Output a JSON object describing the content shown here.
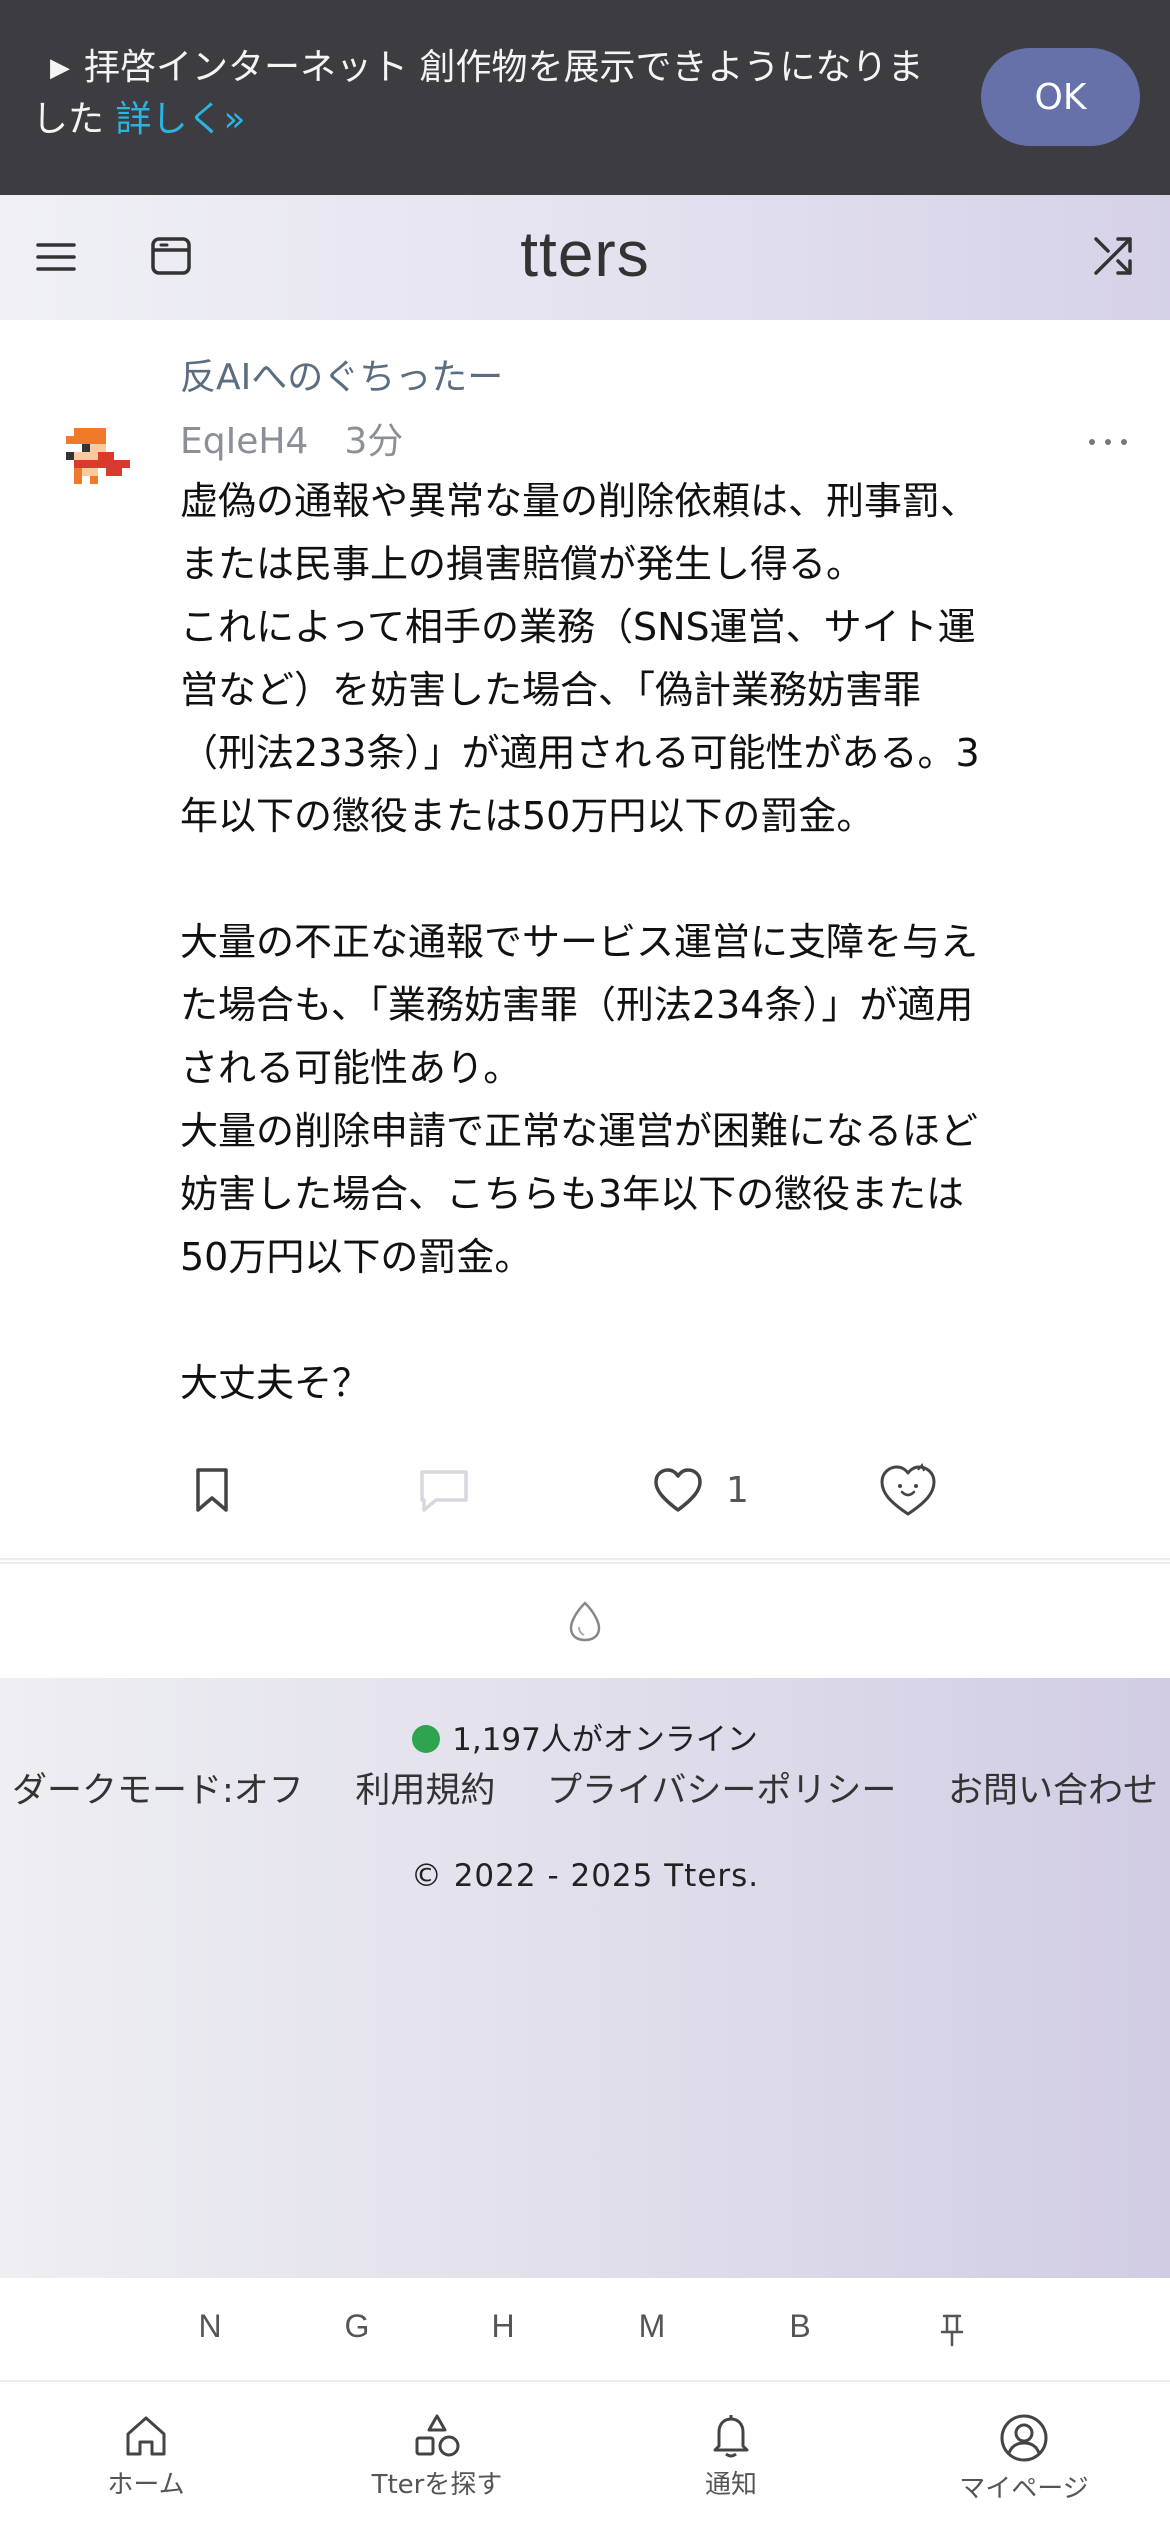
{
  "banner": {
    "text": "拝啓インターネット 創作物を展示できようになりました",
    "more_link": "詳しく»",
    "ok_label": "OK"
  },
  "header": {
    "logo": "tters",
    "icons": [
      "menu-icon",
      "window-icon",
      "shuffle-icon"
    ]
  },
  "post": {
    "source": "反AIへのぐちったー",
    "author": "EqIeH4",
    "time": "3分",
    "body": "虚偽の通報や異常な量の削除依頼は、刑事罰、\nまたは民事上の損害賠償が発生し得る。\nこれによって相手の業務（SNS運営、サイト運\n営など）を妨害した場合、「偽計業務妨害罪\n（刑法233条）」が適用される可能性がある。3\n年以下の懲役または50万円以下の罰金。\n\n大量の不正な通報でサービス運営に支障を与え\nた場合も、「業務妨害罪（刑法234条）」が適用\nされる可能性あり。\n大量の削除申請で正常な運営が困難になるほど\n妨害した場合、こちらも3年以下の懲役または\n50万円以下の罰金。\n\n大丈夫そ？",
    "like_count": "1"
  },
  "footer": {
    "online_text": "1,197人がオンライン",
    "links": [
      "ダークモード:オフ",
      "利用規約",
      "プライバシーポリシー",
      "お問い合わせ"
    ],
    "copyright": "© 2022 - 2025 Tters."
  },
  "shortcuts": [
    "N",
    "G",
    "H",
    "M",
    "B"
  ],
  "nav": {
    "home": "ホーム",
    "explore": "Tterを探す",
    "notifications": "通知",
    "mypage": "マイページ"
  },
  "colors": {
    "banner_bg": "#3d3d41",
    "ok_button": "#6670a9",
    "link_accent": "#2bb4e0",
    "online_dot": "#2ea44f"
  }
}
